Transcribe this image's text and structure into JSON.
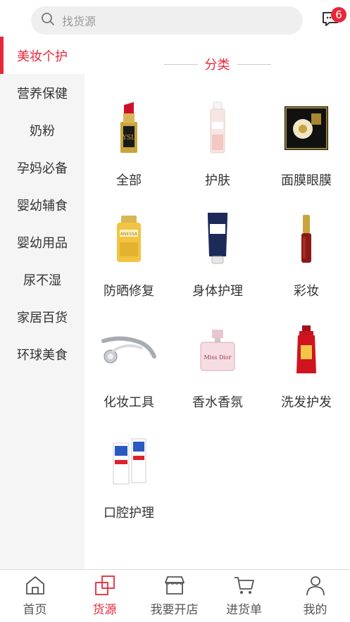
{
  "header": {
    "search_placeholder": "找货源",
    "message_badge": "6"
  },
  "sidebar": {
    "items": [
      {
        "label": "美妆个护",
        "active": true
      },
      {
        "label": "营养保健",
        "active": false
      },
      {
        "label": "奶粉",
        "active": false
      },
      {
        "label": "孕妈必备",
        "active": false
      },
      {
        "label": "婴幼辅食",
        "active": false
      },
      {
        "label": "婴幼用品",
        "active": false
      },
      {
        "label": "尿不湿",
        "active": false
      },
      {
        "label": "家居百货",
        "active": false
      },
      {
        "label": "环球美食",
        "active": false
      }
    ]
  },
  "content": {
    "section_title": "分类",
    "categories": [
      {
        "label": "全部",
        "icon": "lipstick-icon"
      },
      {
        "label": "护肤",
        "icon": "skincare-bottle-icon"
      },
      {
        "label": "面膜眼膜",
        "icon": "face-mask-box-icon"
      },
      {
        "label": "防晒修复",
        "icon": "sunscreen-bottle-icon"
      },
      {
        "label": "身体护理",
        "icon": "body-lotion-tube-icon"
      },
      {
        "label": "彩妆",
        "icon": "lip-gloss-icon"
      },
      {
        "label": "化妆工具",
        "icon": "face-roller-icon"
      },
      {
        "label": "香水香氛",
        "icon": "perfume-bottle-icon"
      },
      {
        "label": "洗发护发",
        "icon": "shampoo-bottle-icon"
      },
      {
        "label": "口腔护理",
        "icon": "toothpaste-icon"
      }
    ]
  },
  "tabbar": {
    "items": [
      {
        "label": "首页",
        "icon": "home-icon",
        "active": false
      },
      {
        "label": "货源",
        "icon": "source-icon",
        "active": true
      },
      {
        "label": "我要开店",
        "icon": "shop-icon",
        "active": false
      },
      {
        "label": "进货单",
        "icon": "cart-icon",
        "active": false
      },
      {
        "label": "我的",
        "icon": "user-icon",
        "active": false
      }
    ]
  },
  "colors": {
    "accent": "#e8283a",
    "sidebar_bg": "#f5f5f5",
    "search_bg": "#efefef"
  }
}
